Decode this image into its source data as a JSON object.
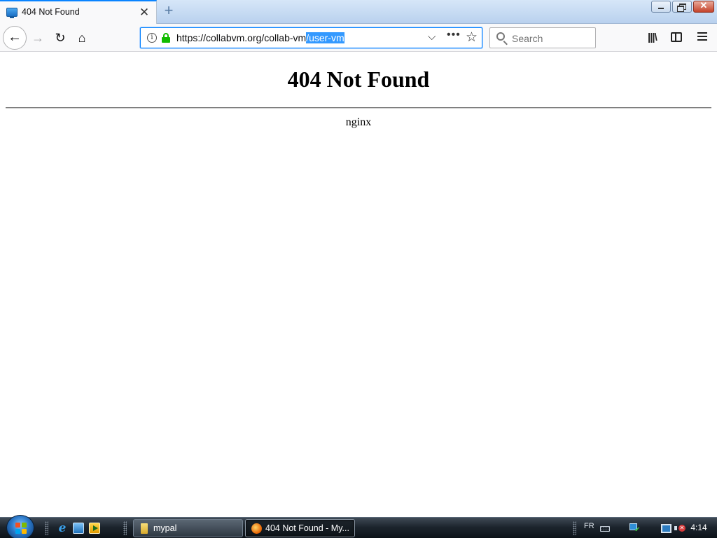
{
  "browser": {
    "tab": {
      "title": "404 Not Found",
      "close_glyph": "✕"
    },
    "new_tab_glyph": "+",
    "window_close_glyph": "✕",
    "nav": {
      "back_glyph": "←",
      "forward_glyph": "→",
      "reload_glyph": "↻",
      "home_glyph": "⌂"
    },
    "url": {
      "before_selection": "https://collabvm.org/collab-vm",
      "selection": "/user-vm",
      "info_glyph": "i",
      "dropdown_glyph": "⌵",
      "more_glyph": "•••",
      "star_glyph": "☆"
    },
    "search": {
      "placeholder": "Search"
    },
    "library_glyph": "|||\\",
    "icons": [
      "globe-favicon",
      "info-icon",
      "lock-icon",
      "search-icon",
      "library-icon",
      "sidebar-icon",
      "menu-icon"
    ],
    "accent_color": "#0a84ff",
    "lock_color": "#12bc00"
  },
  "page": {
    "heading": "404 Not Found",
    "server": "nginx"
  },
  "taskbar": {
    "quick_launch": [
      "internet-explorer-icon",
      "show-desktop-icon",
      "media-player-icon"
    ],
    "ie_glyph": "e",
    "tasks": [
      {
        "label": "mypal",
        "icon": "folder-icon",
        "active": false
      },
      {
        "label": "404 Not Found - My...",
        "icon": "firefox-icon",
        "active": true
      }
    ],
    "tray": {
      "language": "FR",
      "time": "4:14",
      "icons": [
        "keyboard-icon",
        "network-icon",
        "display-icon",
        "volume-muted-icon"
      ]
    }
  }
}
